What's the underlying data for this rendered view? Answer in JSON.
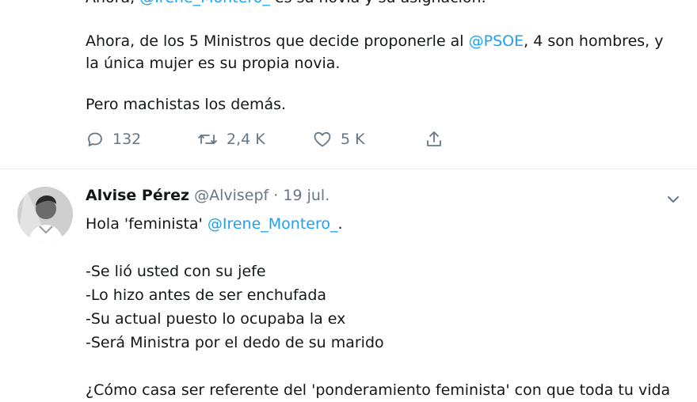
{
  "tweet1": {
    "cut_line_prefix": "Ahora, ",
    "cut_line_mention": "@Irene_Montero_",
    "cut_line_suffix": " es su novia y su asignación.",
    "para1_prefix": "Ahora, de los 5 Ministros que decide proponerle al ",
    "para1_mention": "@PSOE",
    "para1_line1_suffix": ", 4 son hombres, y",
    "para1_line2": "la única mujer es su propia novia.",
    "para2": "Pero machistas los demás.",
    "actions": {
      "reply_count": "132",
      "retweet_count": "2,4 K",
      "like_count": "5 K"
    }
  },
  "tweet2": {
    "author_name": "Alvise Pérez",
    "author_handle": "@Alvisepf",
    "separator": "·",
    "date": "19 jul.",
    "greeting_prefix": "Hola 'feminista' ",
    "greeting_mention": "@Irene_Montero_",
    "greeting_suffix": ".",
    "list_items": [
      "-Se lió usted con su jefe",
      "-Lo hizo antes de ser enchufada",
      "-Su actual puesto lo ocupaba la ex",
      "-Será Ministra por el dedo de su marido"
    ],
    "question": "¿Cómo casa ser referente del 'ponderamiento feminista' con que toda tu vida"
  },
  "colors": {
    "text": "#14171a",
    "muted": "#657786",
    "link": "#1da1f2",
    "divider": "#e6ecf0"
  },
  "icons": {
    "reply": "speech-bubble",
    "retweet": "retweet-arrows",
    "like": "heart-outline",
    "share": "upload-arrow",
    "menu": "chevron-down"
  }
}
